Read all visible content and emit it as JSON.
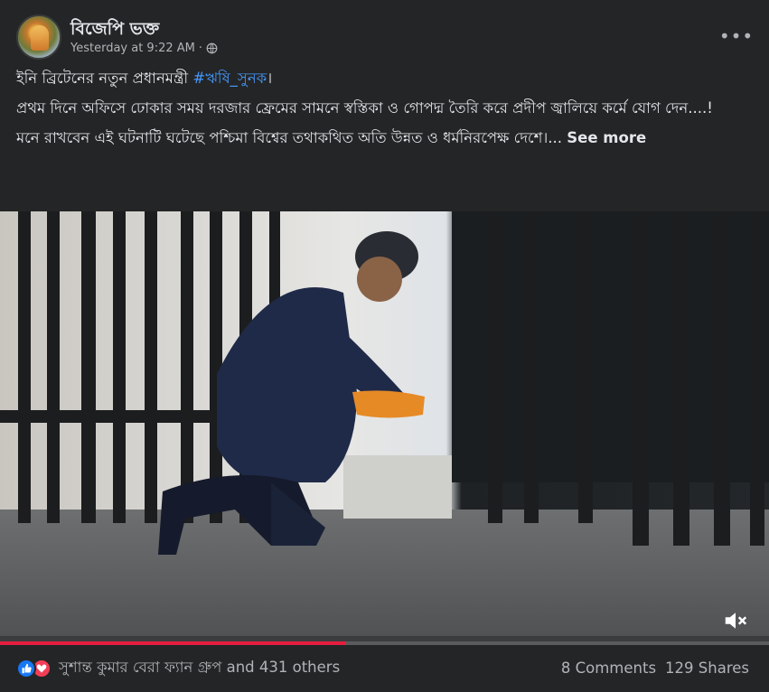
{
  "post": {
    "page_name": "বিজেপি ভক্ত",
    "timestamp": "Yesterday at 9:22 AM",
    "separator": "·",
    "audience_icon": "globe-icon",
    "more_icon": "•••",
    "text": {
      "line1_prefix": "ইনি ব্রিটেনের নতুন প্রধানমন্ত্রী ",
      "hashtag": "#ঋষি_সুনক",
      "line1_suffix": "।",
      "paragraph2": "প্রথম দিনে অফিসে ঢোকার সময় দরজার ফ্রেমের সামনে স্বস্তিকা ও গোপদ্ম তৈরি করে প্রদীপ জ্বালিয়ে কর্মে যোগ দেন....!",
      "paragraph3": " মনে রাখবেন এই ঘটনাটি ঘটেছে পশ্চিমা বিশ্বের তথাকথিত অতি উন্নত ও ধর্মনিরপেক্ষ দেশে।...",
      "see_more": "See more"
    },
    "video": {
      "progress_fraction": 0.45,
      "muted": true,
      "accent": "#e41e3f"
    },
    "footer": {
      "reaction_icons": [
        "like-icon",
        "love-icon"
      ],
      "reactions_text": "সুশান্ত কুমার বেরা ফ্যান গ্রুপ and 431 others",
      "comments": "8 Comments",
      "shares": "129 Shares"
    }
  },
  "colors": {
    "background": "#242526",
    "primary_text": "#e4e6eb",
    "secondary_text": "#b0b3b8",
    "hashtag": "#4599ff",
    "like": "#1877f2",
    "love": "#f33e58"
  }
}
